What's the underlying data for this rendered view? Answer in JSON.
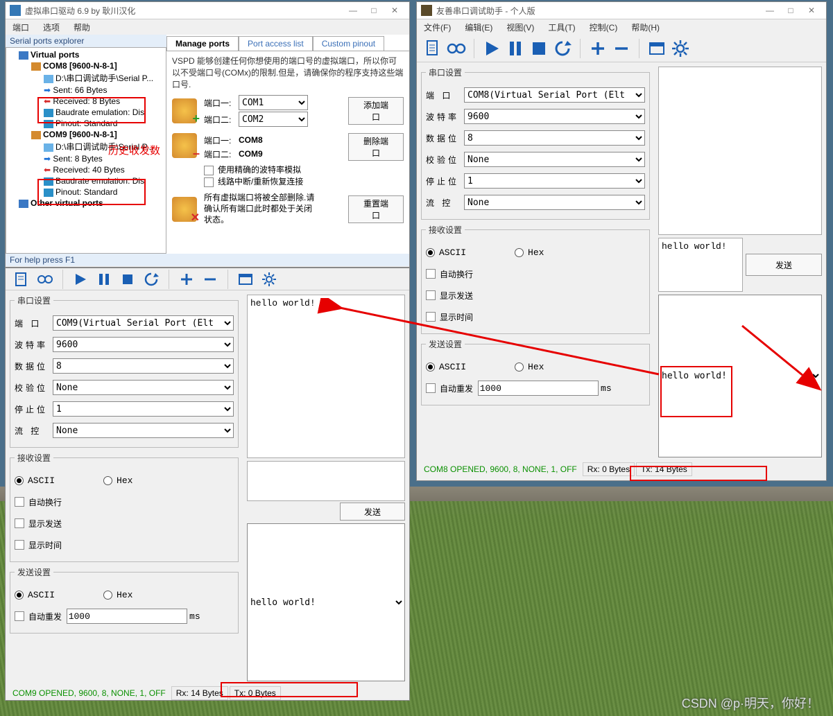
{
  "vspd": {
    "title": "虚拟串口驱动 6.9 by 耿川汉化",
    "menu": [
      "端口",
      "选项",
      "帮助"
    ],
    "explorer_title": "Serial ports explorer",
    "tree": {
      "root": "Virtual ports",
      "com8": {
        "label": "COM8 [9600-N-8-1]",
        "path": "D:\\串口调试助手\\Serial P...",
        "sent": "Sent: 66 Bytes",
        "recv": "Received: 8 Bytes",
        "baud": "Baudrate emulation: Dis",
        "pinout": "Pinout: Standard"
      },
      "com9": {
        "label": "COM9 [9600-N-8-1]",
        "path": "D:\\串口调试助手\\Serial P...",
        "sent": "Sent: 8 Bytes",
        "recv": "Received: 40 Bytes",
        "baud": "Baudrate emulation: Dis",
        "pinout": "Pinout: Standard"
      },
      "other": "Other virtual ports"
    },
    "tabs": [
      "Manage ports",
      "Port access list",
      "Custom pinout"
    ],
    "desc": "VSPD 能够创建任何你想使用的端口号的虚拟端口，所以你可以不受端口号(COMx)的限制.但是，请确保你的程序支持这些端口号.",
    "add": {
      "l1": "端口一:",
      "l2": "端口二:",
      "c1": "COM1",
      "c2": "COM2",
      "btn": "添加端口"
    },
    "del": {
      "l1": "端口一:",
      "l2": "端口二:",
      "c1": "COM8",
      "c2": "COM9",
      "btn": "删除端口",
      "chk1": "使用精确的波特率模拟",
      "chk2": "线路中断/重新恢复连接"
    },
    "reset": {
      "txt": "所有虚拟端口将被全部删除.请确认所有端口此时都处于关闭状态。",
      "btn": "重置端口"
    },
    "help": "For help press F1",
    "annot": "历史收发数"
  },
  "leftTool": {
    "serial": {
      "legend": "串口设置",
      "port_lbl": "端   口",
      "port": "COM9(Virtual Serial Port (Elt",
      "baud_lbl": "波特率",
      "baud": "9600",
      "data_lbl": "数据位",
      "data": "8",
      "parity_lbl": "校验位",
      "parity": "None",
      "stop_lbl": "停止位",
      "stop": "1",
      "flow_lbl": "流   控",
      "flow": "None"
    },
    "recvset": {
      "legend": "接收设置",
      "ascii": "ASCII",
      "hex": "Hex",
      "wrap": "自动换行",
      "show_send": "显示发送",
      "show_time": "显示时间"
    },
    "sendset": {
      "legend": "发送设置",
      "ascii": "ASCII",
      "hex": "Hex",
      "auto": "自动重发",
      "interval": "1000",
      "unit": "ms"
    },
    "recv_text": "hello world!",
    "send_combo": "hello world!",
    "send_btn": "发送",
    "status": {
      "open": "COM9 OPENED, 9600, 8, NONE, 1, OFF",
      "rx": "Rx: 14 Bytes",
      "tx": "Tx: 0 Bytes"
    }
  },
  "rightTool": {
    "title": "友善串口调试助手 - 个人版",
    "menu": [
      "文件(F)",
      "编辑(E)",
      "视图(V)",
      "工具(T)",
      "控制(C)",
      "帮助(H)"
    ],
    "serial": {
      "legend": "串口设置",
      "port_lbl": "端   口",
      "port": "COM8(Virtual Serial Port (Elt",
      "baud_lbl": "波特率",
      "baud": "9600",
      "data_lbl": "数据位",
      "data": "8",
      "parity_lbl": "校验位",
      "parity": "None",
      "stop_lbl": "停止位",
      "stop": "1",
      "flow_lbl": "流   控",
      "flow": "None"
    },
    "recvset": {
      "legend": "接收设置",
      "ascii": "ASCII",
      "hex": "Hex",
      "wrap": "自动换行",
      "show_send": "显示发送",
      "show_time": "显示时间"
    },
    "sendset": {
      "legend": "发送设置",
      "ascii": "ASCII",
      "hex": "Hex",
      "auto": "自动重发",
      "interval": "1000",
      "unit": "ms"
    },
    "send_text": "hello world!",
    "send_combo": "hello world!",
    "send_btn": "发送",
    "status": {
      "open": "COM8 OPENED, 9600, 8, NONE, 1, OFF",
      "rx": "Rx: 0 Bytes",
      "tx": "Tx: 14 Bytes"
    }
  }
}
